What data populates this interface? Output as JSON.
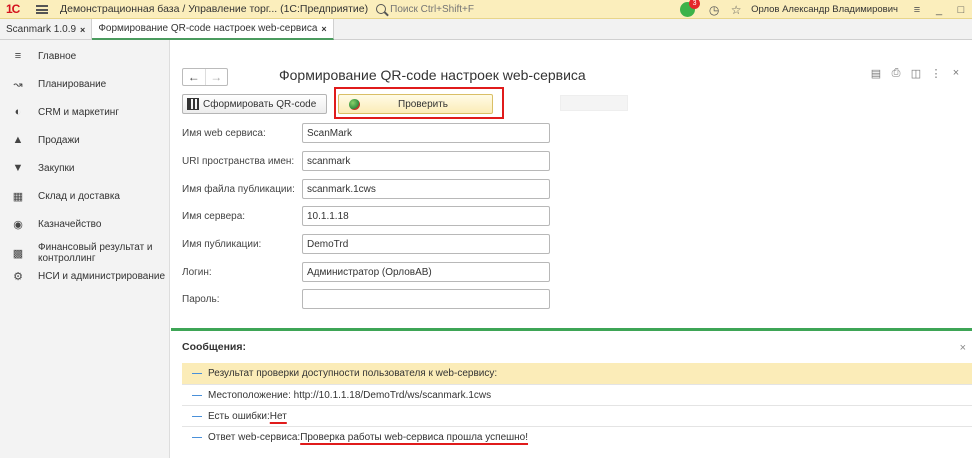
{
  "titlebar": {
    "logo": "1С",
    "app_title": "Демонстрационная база / Управление торг... (1С:Предприятие)",
    "search_placeholder": "Поиск Ctrl+Shift+F",
    "notification_count": "3",
    "user": "Орлов Александр Владимирович"
  },
  "tabs": [
    {
      "label": "Scanmark 1.0.9",
      "close": "×"
    },
    {
      "label": "Формирование QR-code настроек web-сервиса",
      "close": "×"
    }
  ],
  "sidebar": {
    "items": [
      {
        "label": "Главное",
        "icon": "menu-icon"
      },
      {
        "label": "Планирование",
        "icon": "planning-icon"
      },
      {
        "label": "CRM и маркетинг",
        "icon": "crm-icon"
      },
      {
        "label": "Продажи",
        "icon": "sales-icon"
      },
      {
        "label": "Закупки",
        "icon": "cart-icon"
      },
      {
        "label": "Склад и доставка",
        "icon": "warehouse-icon"
      },
      {
        "label": "Казначейство",
        "icon": "treasury-icon"
      },
      {
        "label": "Финансовый результат и контроллинг",
        "icon": "chart-icon"
      },
      {
        "label": "НСИ и администрирование",
        "icon": "gear-icon"
      }
    ]
  },
  "form": {
    "title": "Формирование QR-code настроек web-сервиса",
    "generate_button": "Сформировать QR-code",
    "check_button": "Проверить",
    "fields": [
      {
        "label": "Имя web сервиса:",
        "value": "ScanMark"
      },
      {
        "label": "URI пространства имен:",
        "value": "scanmark"
      },
      {
        "label": "Имя файла публикации:",
        "value": "scanmark.1cws"
      },
      {
        "label": "Имя сервера:",
        "value": "10.1.1.18"
      },
      {
        "label": "Имя публикации:",
        "value": "DemoTrd"
      },
      {
        "label": "Логин:",
        "value": "Администратор (ОрловАВ)"
      },
      {
        "label": "Пароль:",
        "value": ""
      }
    ]
  },
  "messages": {
    "title": "Сообщения:",
    "close": "×",
    "items": [
      {
        "text": "Результат проверки доступности пользователя к web-сервису:"
      },
      {
        "text": "Местоположение: http://10.1.1.18/DemoTrd/ws/scanmark.1cws"
      },
      {
        "prefix": "Есть ошибки: ",
        "highlight": "Нет"
      },
      {
        "prefix": "Ответ web-сервиса: ",
        "highlight": "Проверка работы web-сервиса прошла успешно!"
      }
    ]
  },
  "colors": {
    "accent_green": "#3ea556",
    "highlight_red": "#e01b1b",
    "titlebar_bg": "#fbeebc"
  }
}
